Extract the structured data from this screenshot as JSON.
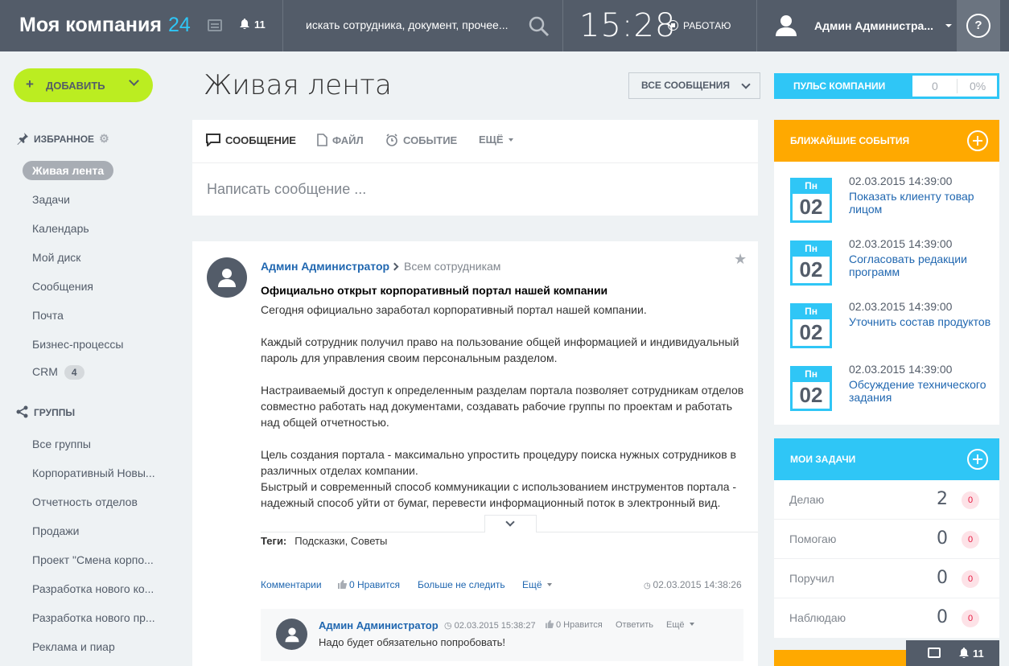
{
  "header": {
    "company": "Моя компания",
    "company_count": "24",
    "notifications": "11",
    "search_placeholder": "искать сотрудника, документ, прочее...",
    "time": "15:28",
    "work_status": "РАБОТАЮ",
    "user_name": "Админ Администра...",
    "help": "?"
  },
  "sidebar": {
    "add_label": "ДОБАВИТЬ",
    "favorites_title": "ИЗБРАННОЕ",
    "favorites": [
      {
        "label": "Живая лента"
      },
      {
        "label": "Задачи"
      },
      {
        "label": "Календарь"
      },
      {
        "label": "Мой диск"
      },
      {
        "label": "Сообщения"
      },
      {
        "label": "Почта"
      },
      {
        "label": "Бизнес-процессы"
      },
      {
        "label": "CRM",
        "count": "4"
      }
    ],
    "groups_title": "ГРУППЫ",
    "groups": [
      {
        "label": "Все группы"
      },
      {
        "label": "Корпоративный Новы..."
      },
      {
        "label": "Отчетность отделов"
      },
      {
        "label": "Продажи"
      },
      {
        "label": "Проект \"Смена корпо..."
      },
      {
        "label": "Разработка нового ко..."
      },
      {
        "label": "Разработка нового пр..."
      },
      {
        "label": "Реклама и пиар"
      }
    ]
  },
  "main": {
    "title": "Живая лента",
    "filter": "ВСЕ СООБЩЕНИЯ",
    "tabs": [
      "СООБЩЕНИЕ",
      "ФАЙЛ",
      "СОБЫТИЕ",
      "ЕЩЁ"
    ],
    "write_placeholder": "Написать сообщение ...",
    "post": {
      "author": "Админ Администратор",
      "recipient": "Всем сотрудникам",
      "title": "Официально открыт корпоративный портал нашей компании",
      "paragraphs": [
        "Сегодня официально заработал корпоративный портал нашей компании.",
        "Каждый сотрудник получил право на пользование общей информацией и индивидуальный пароль для управления своим персональным разделом.",
        "Настраиваемый доступ к определенным разделам портала позволяет сотрудникам отделов совместно работать над документами, создавать рабочие группы по проектам и работать над общей отчетностью.",
        "Цель создания портала - максимально упростить процедуру поиска нужных сотрудников в различных отделах компании.",
        "Быстрый и современный способ коммуникации с использованием инструментов портала - надежный способ уйти от бумаг, перевести информационный поток в электронный вид."
      ],
      "tags_label": "Теги:",
      "tags": "Подсказки, Советы",
      "actions": {
        "comments": "Комментарии",
        "likes": "0 Нравится",
        "unfollow": "Больше не следить",
        "more": "Ещё",
        "datetime": "02.03.2015 14:38:26"
      },
      "comment": {
        "author": "Админ Администратор",
        "datetime": "02.03.2015 15:38:27",
        "likes": "0 Нравится",
        "reply": "Ответить",
        "more": "Ещё",
        "text": "Надо будет обязательно попробовать!"
      }
    }
  },
  "right": {
    "pulse_label": "ПУЛЬС КОМПАНИИ",
    "pulse_value": "0",
    "pulse_percent": "0%",
    "events_title": "БЛИЖАЙШИЕ СОБЫТИЯ",
    "events": [
      {
        "day": "Пн",
        "num": "02",
        "datetime": "02.03.2015 14:39:00",
        "title": "Показать клиенту товар лицом"
      },
      {
        "day": "Пн",
        "num": "02",
        "datetime": "02.03.2015 14:39:00",
        "title": "Согласовать редакции программ"
      },
      {
        "day": "Пн",
        "num": "02",
        "datetime": "02.03.2015 14:39:00",
        "title": "Уточнить состав продуктов"
      },
      {
        "day": "Пн",
        "num": "02",
        "datetime": "02.03.2015 14:39:00",
        "title": "Обсуждение технического задания"
      }
    ],
    "tasks_title": "МОИ ЗАДАЧИ",
    "tasks": [
      {
        "label": "Делаю",
        "count": "2",
        "badge": "0"
      },
      {
        "label": "Помогаю",
        "count": "0",
        "badge": "0"
      },
      {
        "label": "Поручил",
        "count": "0",
        "badge": "0"
      },
      {
        "label": "Наблюдаю",
        "count": "0",
        "badge": "0"
      }
    ],
    "bottom_notifications": "11"
  },
  "colors": {
    "header_bg": "#535c69",
    "accent_blue": "#2fc6f6",
    "add_green": "#bbed21",
    "events_orange": "#ffa900",
    "link_blue": "#2067b0"
  },
  "icons": [
    "chat-icon",
    "bell-icon",
    "search-icon",
    "user-icon",
    "help-icon",
    "pin-icon",
    "gear-icon",
    "share-icon",
    "message-icon",
    "file-icon",
    "clock-icon",
    "star-icon",
    "like-icon",
    "plus-icon",
    "chevron-down-icon"
  ]
}
